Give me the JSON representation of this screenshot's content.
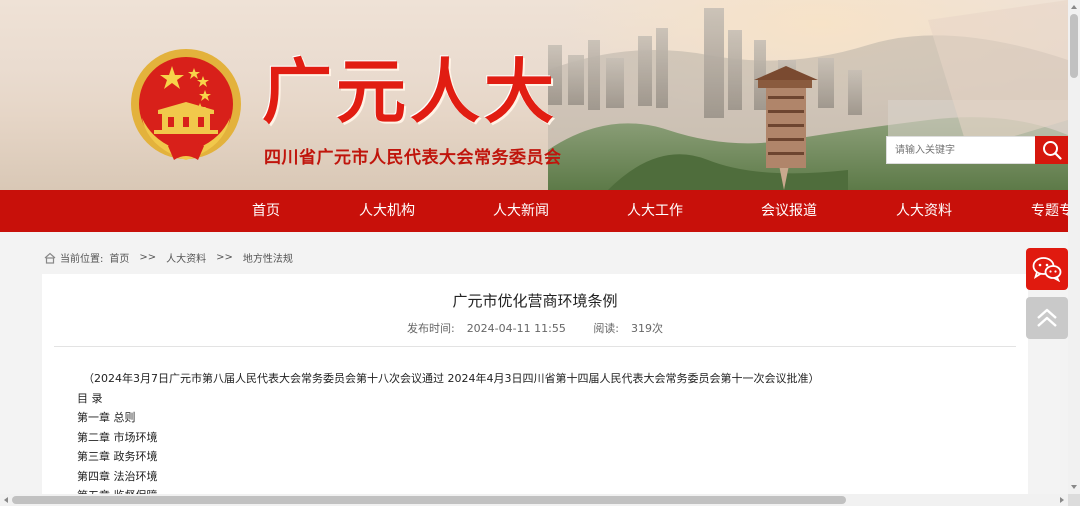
{
  "header": {
    "site_name": "广元人大",
    "subtitle": "四川省广元市人民代表大会常务委员会",
    "search_placeholder": "请输入关键字"
  },
  "nav": {
    "items": [
      "首页",
      "人大机构",
      "人大新闻",
      "人大工作",
      "会议报道",
      "人大资料",
      "专题专"
    ]
  },
  "breadcrumb": {
    "label": "当前位置:",
    "items": [
      "首页",
      "人大资料",
      "地方性法规"
    ],
    "separator": ">>"
  },
  "article": {
    "title": "广元市优化营商环境条例",
    "published_label": "发布时间:",
    "published_value": "2024-04-11 11:55",
    "views_label": "阅读:",
    "views_value": "319次",
    "lines": [
      "（2024年3月7日广元市第八届人民代表大会常务委员会第十八次会议通过  2024年4月3日四川省第十四届人民代表大会常务委员会第十一次会议批准）",
      "目  录",
      "第一章  总则",
      "第二章  市场环境",
      "第三章  政务环境",
      "第四章  法治环境",
      "第五章  监督保障"
    ]
  },
  "colors": {
    "brand_red": "#c8100a",
    "title_red": "#e11d12",
    "float_red": "#e01a0f"
  },
  "icons": [
    "search-icon",
    "home-icon",
    "wechat-icon",
    "back-to-top-icon"
  ]
}
